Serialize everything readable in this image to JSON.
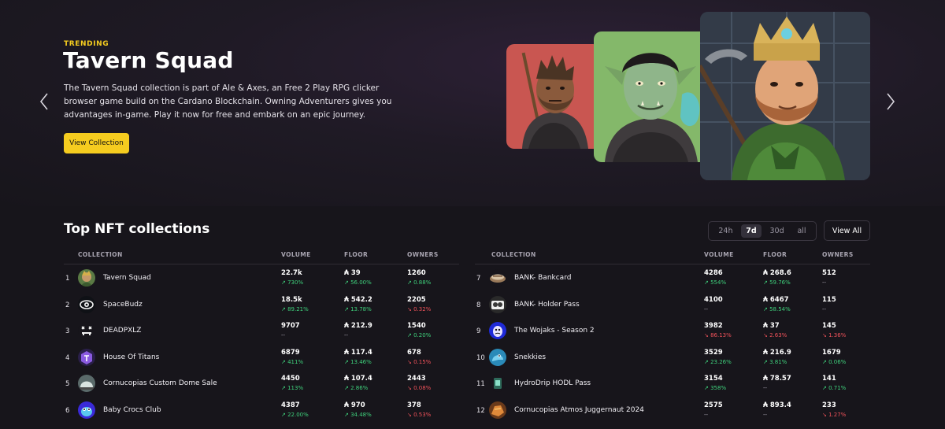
{
  "hero": {
    "kicker": "TRENDING",
    "title": "Tavern Squad",
    "description": "The Tavern Squad collection is part of Ale & Axes, an Free 2 Play RPG clicker browser game build on the Cardano Blockchain. Owning Adventurers gives you advantages in-game. Play it now for free and embark on an epic journey.",
    "button_label": "View Collection",
    "accent_color": "#f5cc1f"
  },
  "section": {
    "title": "Top NFT collections",
    "periods": [
      "24h",
      "7d",
      "30d",
      "all"
    ],
    "active_period": "7d",
    "view_all_label": "View All"
  },
  "columns": {
    "collection": "COLLECTION",
    "volume": "VOLUME",
    "floor": "FLOOR",
    "owners": "OWNERS"
  },
  "left": [
    {
      "rank": "1",
      "name": "Tavern Squad",
      "volume": "22.7k",
      "volume_change": "↗ 730%",
      "volume_dir": "up",
      "floor": "₳ 39",
      "floor_change": "↗ 56.00%",
      "floor_dir": "up",
      "owners": "1260",
      "owners_change": "↗ 0.88%",
      "owners_dir": "up",
      "icon": "tavern-squad-avatar"
    },
    {
      "rank": "2",
      "name": "SpaceBudz",
      "volume": "18.5k",
      "volume_change": "↗ 89.21%",
      "volume_dir": "up",
      "floor": "₳ 542.2",
      "floor_change": "↗ 13.78%",
      "floor_dir": "up",
      "owners": "2205",
      "owners_change": "↘ 0.32%",
      "owners_dir": "down",
      "icon": "spacebudz-eye-avatar"
    },
    {
      "rank": "3",
      "name": "DEADPXLZ",
      "volume": "9707",
      "volume_change": "--",
      "volume_dir": "na",
      "floor": "₳ 212.9",
      "floor_change": "--",
      "floor_dir": "na",
      "owners": "1540",
      "owners_change": "↗ 0.20%",
      "owners_dir": "up",
      "icon": "deadpxlz-avatar"
    },
    {
      "rank": "4",
      "name": "House Of Titans",
      "volume": "6879",
      "volume_change": "↗ 411%",
      "volume_dir": "up",
      "floor": "₳ 117.4",
      "floor_change": "↗ 13.46%",
      "floor_dir": "up",
      "owners": "678",
      "owners_change": "↘ 0.15%",
      "owners_dir": "down",
      "icon": "house-of-titans-avatar"
    },
    {
      "rank": "5",
      "name": "Cornucopias Custom Dome Sale",
      "volume": "4450",
      "volume_change": "↗ 113%",
      "volume_dir": "up",
      "floor": "₳ 107.4",
      "floor_change": "↗ 2.86%",
      "floor_dir": "up",
      "owners": "2443",
      "owners_change": "↘ 0.08%",
      "owners_dir": "down",
      "icon": "cornucopias-dome-avatar"
    },
    {
      "rank": "6",
      "name": "Baby Crocs Club",
      "volume": "4387",
      "volume_change": "↗ 22.00%",
      "volume_dir": "up",
      "floor": "₳ 970",
      "floor_change": "↗ 34.48%",
      "floor_dir": "up",
      "owners": "378",
      "owners_change": "↘ 0.53%",
      "owners_dir": "down",
      "icon": "baby-crocs-avatar"
    }
  ],
  "right": [
    {
      "rank": "7",
      "name": "BANK- Bankcard",
      "volume": "4286",
      "volume_change": "↗ 554%",
      "volume_dir": "up",
      "floor": "₳ 268.6",
      "floor_change": "↗ 59.76%",
      "floor_dir": "up",
      "owners": "512",
      "owners_change": "--",
      "owners_dir": "na",
      "icon": "bankcard-avatar"
    },
    {
      "rank": "8",
      "name": "BANK- Holder Pass",
      "volume": "4100",
      "volume_change": "--",
      "volume_dir": "na",
      "floor": "₳ 6467",
      "floor_change": "↗ 58.54%",
      "floor_dir": "up",
      "owners": "115",
      "owners_change": "--",
      "owners_dir": "na",
      "icon": "holder-pass-avatar"
    },
    {
      "rank": "9",
      "name": "The Wojaks - Season 2",
      "volume": "3982",
      "volume_change": "↘ 86.13%",
      "volume_dir": "down",
      "floor": "₳ 37",
      "floor_change": "↘ 2.63%",
      "floor_dir": "down",
      "owners": "145",
      "owners_change": "↘ 1.36%",
      "owners_dir": "down",
      "icon": "wojaks-avatar"
    },
    {
      "rank": "10",
      "name": "Snekkies",
      "volume": "3529",
      "volume_change": "↗ 23.26%",
      "volume_dir": "up",
      "floor": "₳ 216.9",
      "floor_change": "↗ 3.81%",
      "floor_dir": "up",
      "owners": "1679",
      "owners_change": "↗ 0.06%",
      "owners_dir": "up",
      "icon": "snekkies-avatar"
    },
    {
      "rank": "11",
      "name": "HydroDrip HODL Pass",
      "volume": "3154",
      "volume_change": "↗ 358%",
      "volume_dir": "up",
      "floor": "₳ 78.57",
      "floor_change": "--",
      "floor_dir": "na",
      "owners": "141",
      "owners_change": "↗ 0.71%",
      "owners_dir": "up",
      "icon": "hydrodrip-avatar"
    },
    {
      "rank": "12",
      "name": "Cornucopias Atmos Juggernaut 2024",
      "volume": "2575",
      "volume_change": "--",
      "volume_dir": "na",
      "floor": "₳ 893.4",
      "floor_change": "--",
      "floor_dir": "na",
      "owners": "233",
      "owners_change": "↘ 1.27%",
      "owners_dir": "down",
      "icon": "cornucopias-juggernaut-avatar"
    }
  ]
}
